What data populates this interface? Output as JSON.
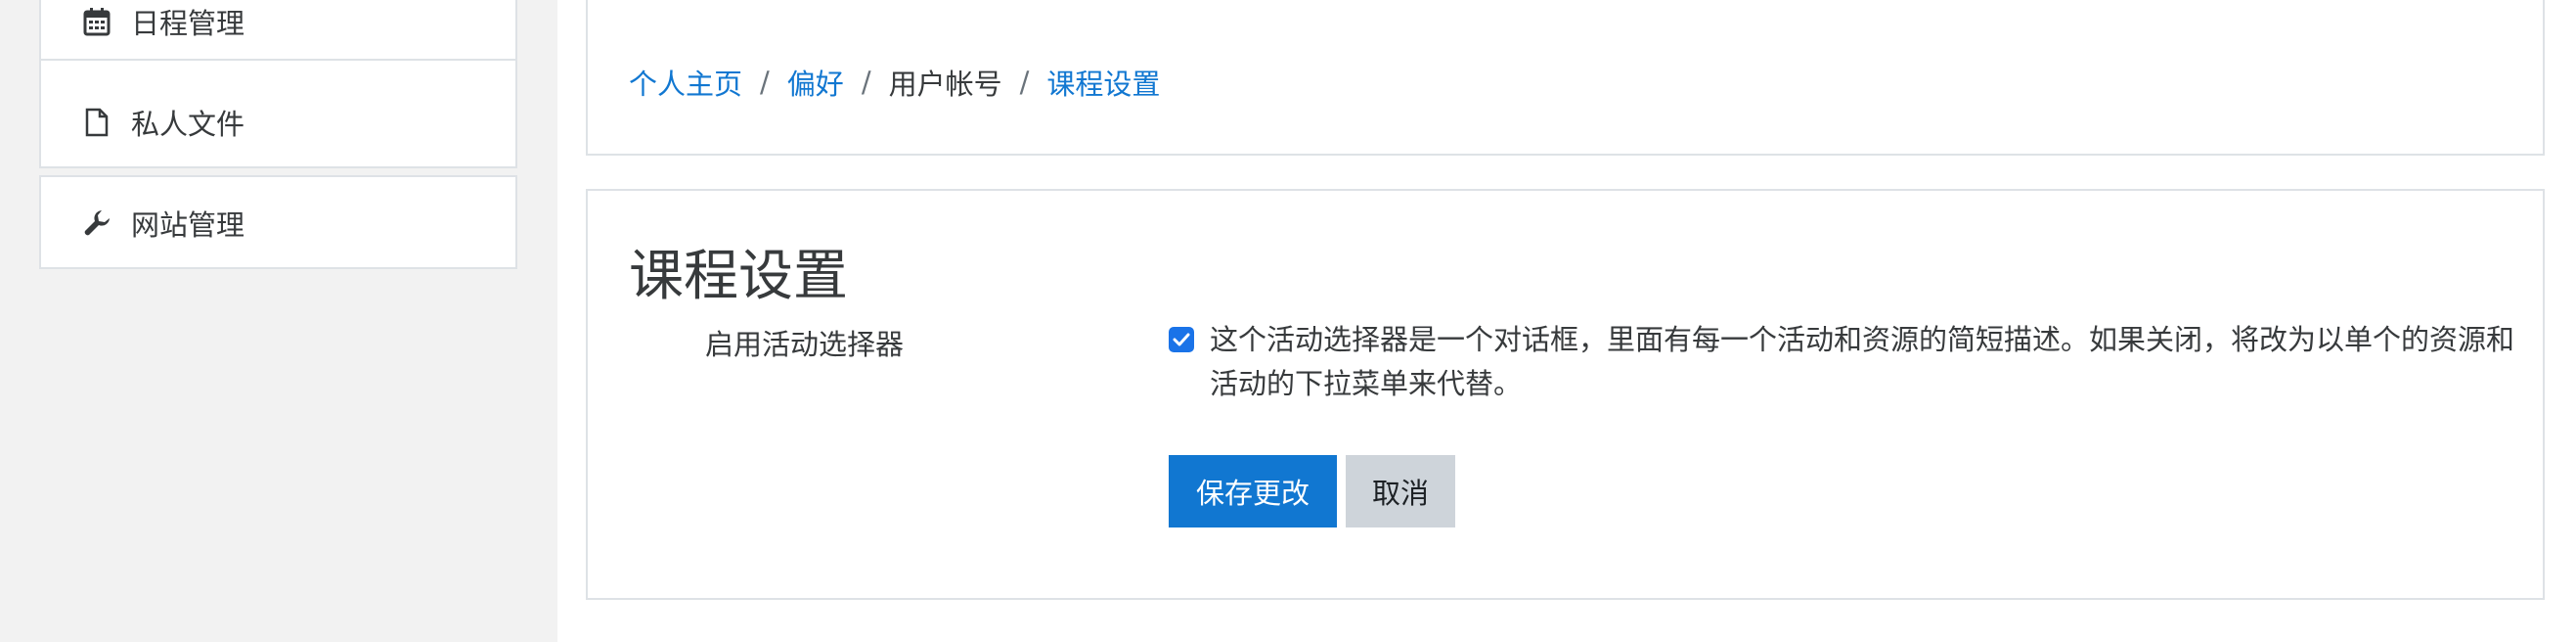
{
  "sidebar": {
    "items": [
      {
        "label": "日程管理",
        "icon": "calendar-icon"
      },
      {
        "label": "私人文件",
        "icon": "file-icon"
      }
    ],
    "admin": {
      "label": "网站管理",
      "icon": "wrench-icon"
    }
  },
  "breadcrumb": {
    "items": [
      {
        "label": "个人主页",
        "link": true
      },
      {
        "label": "偏好",
        "link": true
      },
      {
        "label": "用户帐号",
        "link": false
      },
      {
        "label": "课程设置",
        "link": true
      }
    ],
    "separator": "/"
  },
  "main": {
    "title": "课程设置",
    "setting_label": "启用活动选择器",
    "checkbox_checked": true,
    "setting_description": "这个活动选择器是一个对话框，里面有每一个活动和资源的简短描述。如果关闭，将改为以单个的资源和活动的下拉菜单来代替。",
    "save_label": "保存更改",
    "cancel_label": "取消"
  },
  "colors": {
    "link": "#1177d1",
    "primary_button": "#1177d1",
    "secondary_button": "#ced4da",
    "checkbox": "#1a73e8"
  }
}
